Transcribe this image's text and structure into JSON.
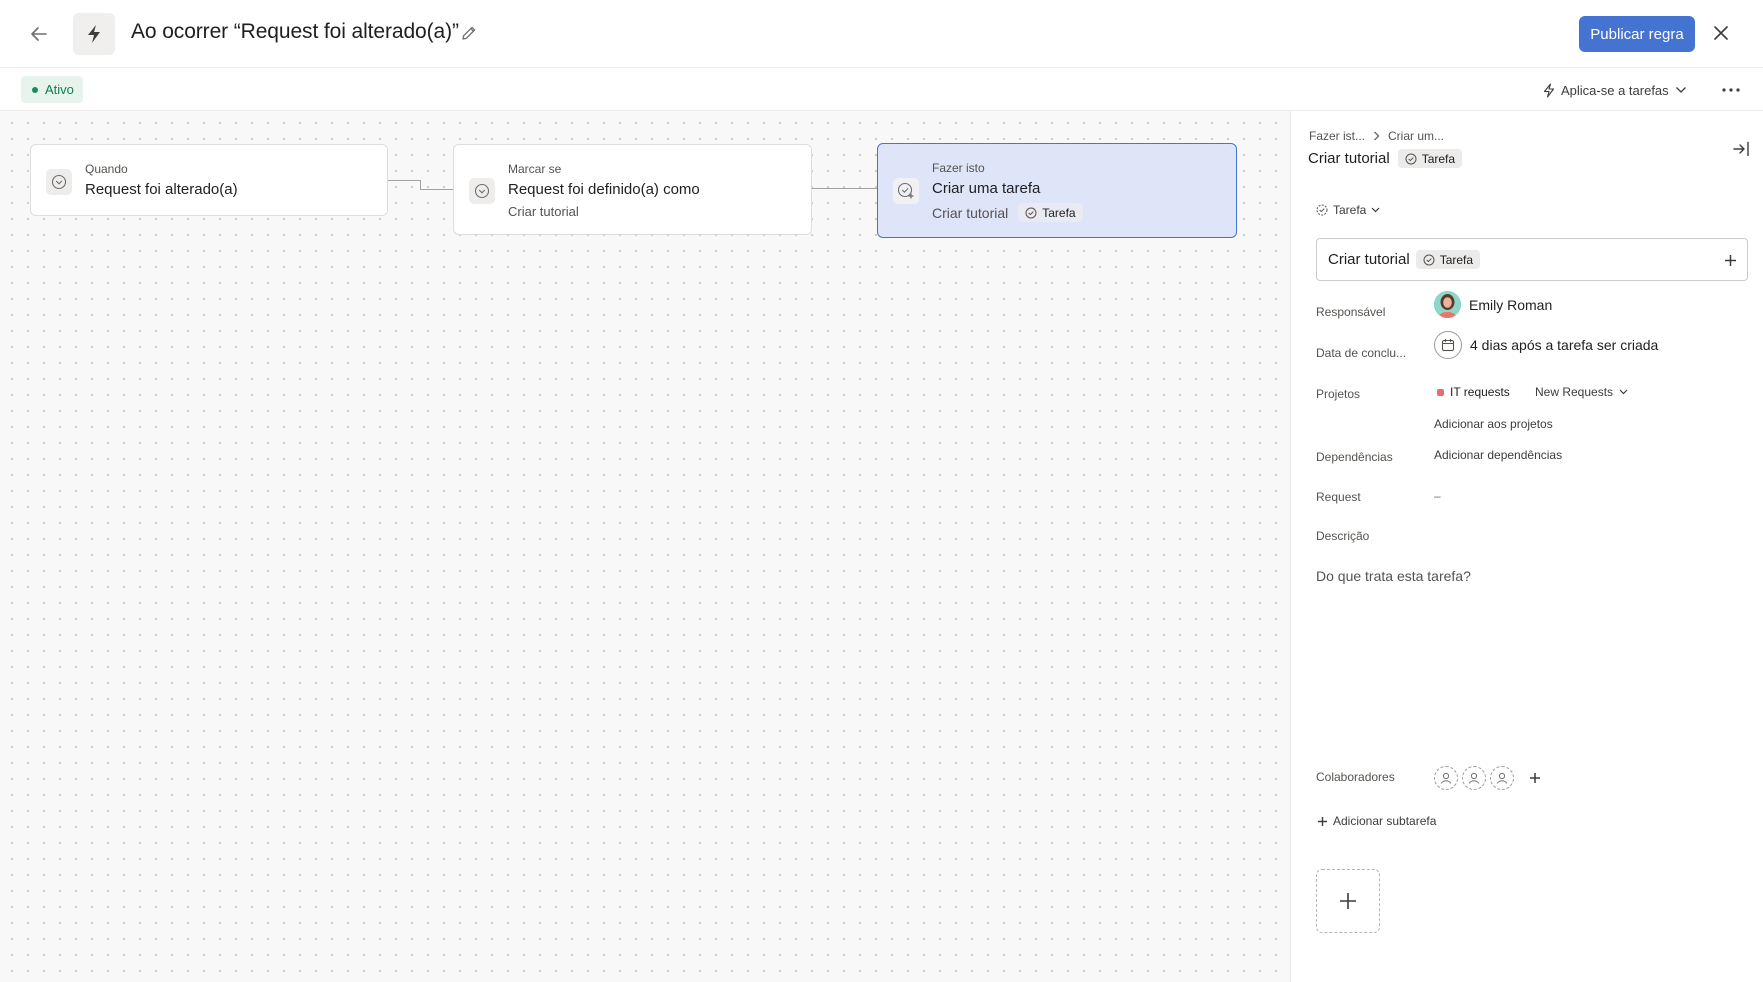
{
  "header": {
    "title": "Ao ocorrer “Request foi alterado(a)”",
    "publish_label": "Publicar regra"
  },
  "subheader": {
    "status": "Ativo",
    "applies_label": "Aplica-se a tarefas"
  },
  "flow": {
    "nodes": [
      {
        "label": "Quando",
        "title": "Request foi alterado(a)",
        "icon": "chevron-circle-icon"
      },
      {
        "label": "Marcar se",
        "title": "Request foi definido(a) como",
        "sub": "Criar tutorial",
        "icon": "chevron-circle-icon"
      },
      {
        "label": "Fazer isto",
        "title": "Criar uma tarefa",
        "sub": "Criar tutorial",
        "tag": "Tarefa",
        "icon": "task-add-icon"
      }
    ]
  },
  "panel": {
    "breadcrumb": [
      "Fazer ist...",
      "Criar um..."
    ],
    "title": "Criar tutorial",
    "title_tag": "Tarefa",
    "type_select": "Tarefa",
    "name_value": "Criar tutorial",
    "name_tag": "Tarefa",
    "fields": {
      "assignee_label": "Responsável",
      "assignee_value": "Emily Roman",
      "due_label": "Data de conclu...",
      "due_value": "4 dias após a tarefa ser criada",
      "projects_label": "Projetos",
      "project_name": "IT requests",
      "project_section": "New Requests",
      "add_projects": "Adicionar aos projetos",
      "dependencies_label": "Dependências",
      "add_dependencies": "Adicionar dependências",
      "request_label": "Request",
      "request_value": "–",
      "description_label": "Descrição",
      "description_placeholder": "Do que trata esta tarefa?",
      "collaborators_label": "Colaboradores",
      "add_subtask": "Adicionar subtarefa"
    }
  },
  "colors": {
    "accent": "#4573d2",
    "selected_node_bg": "#dfe5f9",
    "status_green": "#0d7f4f",
    "project_dot": "#f06a6a"
  }
}
